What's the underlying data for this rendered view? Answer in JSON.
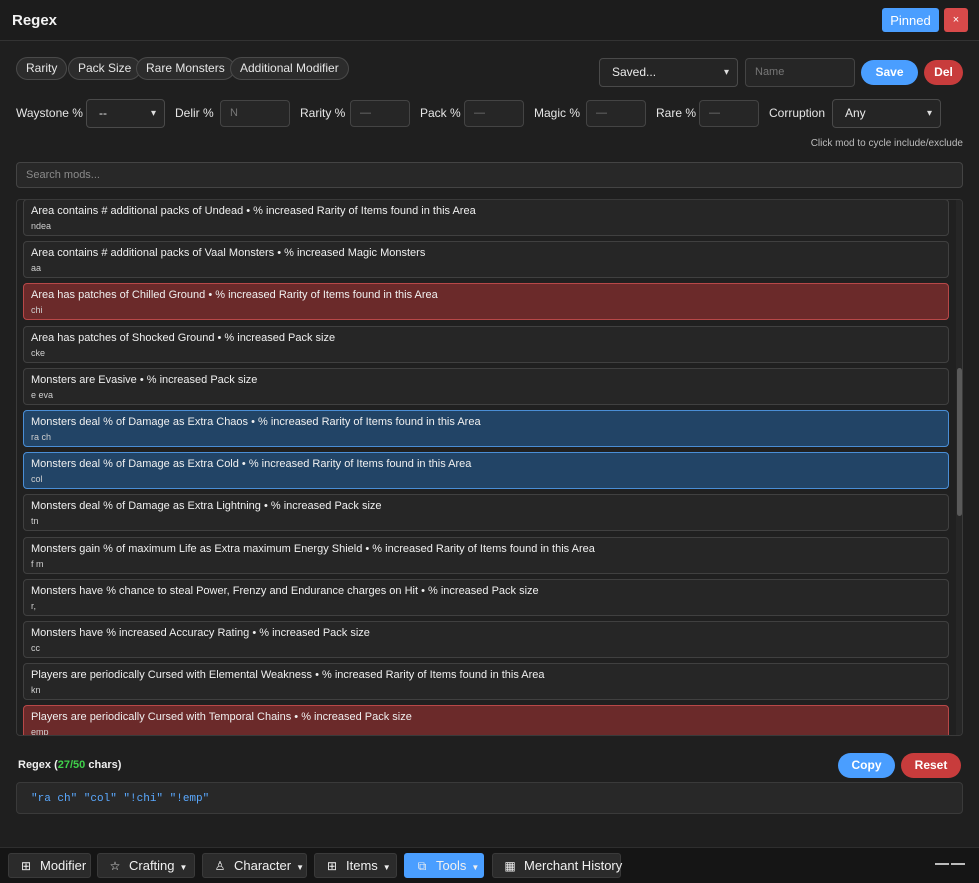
{
  "window": {
    "title": "Regex",
    "pinned_label": "Pinned",
    "close_label": "×"
  },
  "chips": [
    "Rarity",
    "Pack Size",
    "Rare Monsters",
    "Additional Modifier"
  ],
  "presets": {
    "select_value": "Saved...",
    "name_placeholder": "Name",
    "save_label": "Save",
    "delete_label": "Del"
  },
  "filters": {
    "waystone_label": "Waystone %",
    "waystone_value": "--",
    "delir_label": "Delir %",
    "delir_placeholder": "N",
    "rarity_label": "Rarity %",
    "rarity_placeholder": "—",
    "pack_label": "Pack %",
    "pack_placeholder": "—",
    "magic_label": "Magic %",
    "magic_placeholder": "—",
    "rare_label": "Rare %",
    "rare_placeholder": "—",
    "corruption_label": "Corruption",
    "corruption_value": "Any"
  },
  "hint": "Click mod to cycle include/exclude",
  "search": {
    "placeholder": "Search mods..."
  },
  "mods": [
    {
      "text": "Area contains # additional packs of Undead • % increased Rarity of Items found in this Area",
      "code": "ndea",
      "state": "none"
    },
    {
      "text": "Area contains # additional packs of Vaal Monsters • % increased Magic Monsters",
      "code": "aa",
      "state": "none"
    },
    {
      "text": "Area has patches of Chilled Ground • % increased Rarity of Items found in this Area",
      "code": "chi",
      "state": "exclude"
    },
    {
      "text": "Area has patches of Shocked Ground • % increased Pack size",
      "code": "cke",
      "state": "none"
    },
    {
      "text": "Monsters are Evasive • % increased Pack size",
      "code": "e eva",
      "state": "none"
    },
    {
      "text": "Monsters deal % of Damage as Extra Chaos • % increased Rarity of Items found in this Area",
      "code": "ra ch",
      "state": "include"
    },
    {
      "text": "Monsters deal % of Damage as Extra Cold • % increased Rarity of Items found in this Area",
      "code": "col",
      "state": "include"
    },
    {
      "text": "Monsters deal % of Damage as Extra Lightning • % increased Pack size",
      "code": "tn",
      "state": "none"
    },
    {
      "text": "Monsters gain % of maximum Life as Extra maximum Energy Shield • % increased Rarity of Items found in this Area",
      "code": "f m",
      "state": "none"
    },
    {
      "text": "Monsters have % chance to steal Power, Frenzy and Endurance charges on Hit • % increased Pack size",
      "code": "r,",
      "state": "none"
    },
    {
      "text": "Monsters have % increased Accuracy Rating • % increased Pack size",
      "code": "cc",
      "state": "none"
    },
    {
      "text": "Players are periodically Cursed with Elemental Weakness • % increased Rarity of Items found in this Area",
      "code": "kn",
      "state": "none"
    },
    {
      "text": "Players are periodically Cursed with Temporal Chains • % increased Pack size",
      "code": "emp",
      "state": "exclude"
    }
  ],
  "regex": {
    "label": "Regex",
    "count": "27/50",
    "suffix": "chars",
    "value": "\"ra ch\" \"col\" \"!chi\" \"!emp\"",
    "copy_label": "Copy",
    "reset_label": "Reset"
  },
  "taskbar": [
    {
      "label": "Modifier",
      "icon": "grid-icon",
      "caret": false,
      "active": false
    },
    {
      "label": "Crafting",
      "icon": "star-icon",
      "caret": true,
      "active": false
    },
    {
      "label": "Character",
      "icon": "person-icon",
      "caret": true,
      "active": false
    },
    {
      "label": "Items",
      "icon": "grid-icon",
      "caret": true,
      "active": false
    },
    {
      "label": "Tools",
      "icon": "toolbox-icon",
      "caret": true,
      "active": true
    },
    {
      "label": "Merchant History",
      "icon": "table-icon",
      "caret": false,
      "active": false
    }
  ],
  "colors": {
    "accent": "#4a9eff",
    "danger": "#c83c3c",
    "include": "#224466",
    "exclude": "#6b2a2a",
    "count_ok": "#3fd14a",
    "regex_text": "#5aa9ff"
  }
}
